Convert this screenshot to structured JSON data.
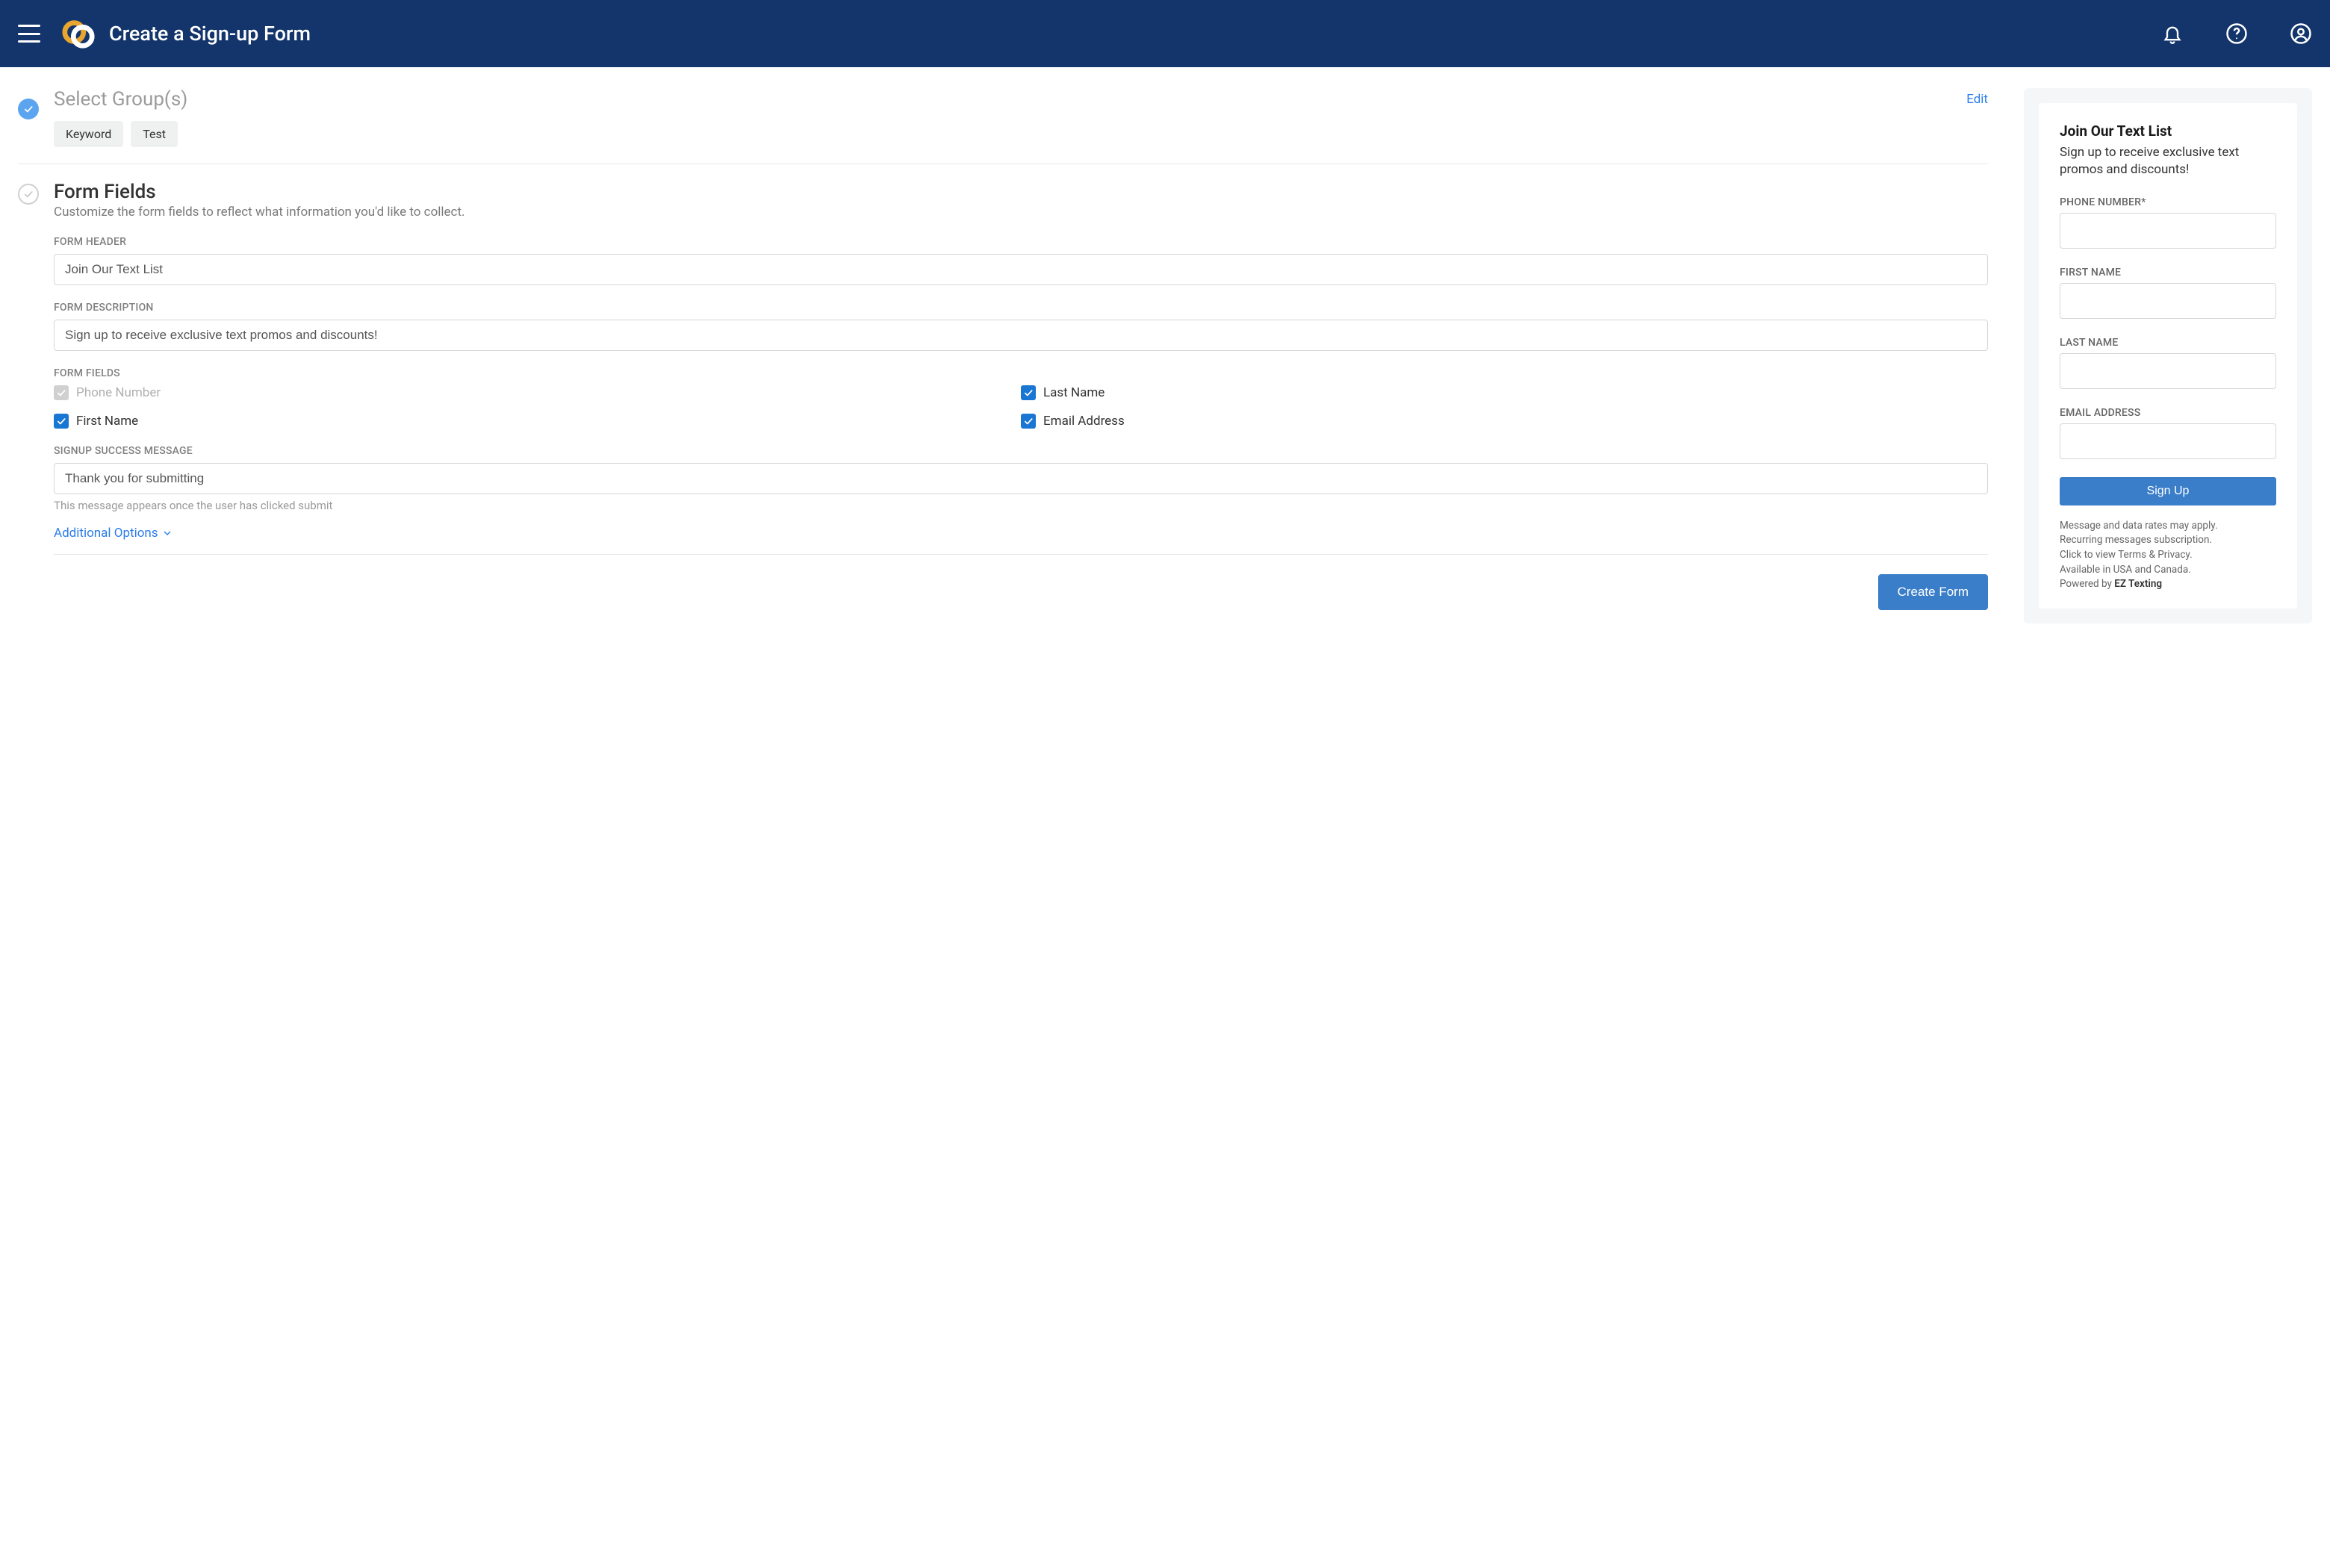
{
  "header": {
    "title": "Create a Sign-up Form"
  },
  "groups": {
    "title": "Select Group(s)",
    "edit": "Edit",
    "chips": [
      "Keyword",
      "Test"
    ]
  },
  "formFields": {
    "title": "Form Fields",
    "subtitle": "Customize the form fields to reflect what information you'd like to collect.",
    "labels": {
      "header": "FORM HEADER",
      "description": "FORM DESCRIPTION",
      "fields": "FORM FIELDS",
      "success": "SIGNUP SUCCESS MESSAGE"
    },
    "values": {
      "header": "Join Our Text List",
      "description": "Sign up to receive exclusive text promos and discounts!",
      "success": "Thank you for submitting"
    },
    "successHelper": "This message appears once the user has clicked submit",
    "fields": [
      {
        "label": "Phone Number",
        "checked": true,
        "disabled": true
      },
      {
        "label": "Last Name",
        "checked": true,
        "disabled": false
      },
      {
        "label": "First Name",
        "checked": true,
        "disabled": false
      },
      {
        "label": "Email Address",
        "checked": true,
        "disabled": false
      }
    ],
    "additionalOptions": "Additional Options"
  },
  "actions": {
    "createForm": "Create Form"
  },
  "preview": {
    "title": "Join Our Text List",
    "description": "Sign up to receive exclusive text promos and discounts!",
    "labels": {
      "phone": "PHONE NUMBER*",
      "first": "FIRST NAME",
      "last": "LAST NAME",
      "email": "EMAIL ADDRESS"
    },
    "button": "Sign Up",
    "fineprint": {
      "l1": "Message and data rates may apply.",
      "l2": "Recurring messages subscription.",
      "l3": "Click to view Terms & Privacy.",
      "l4": "Available in USA and Canada.",
      "l5a": "Powered by ",
      "l5b": "EZ Texting"
    }
  }
}
